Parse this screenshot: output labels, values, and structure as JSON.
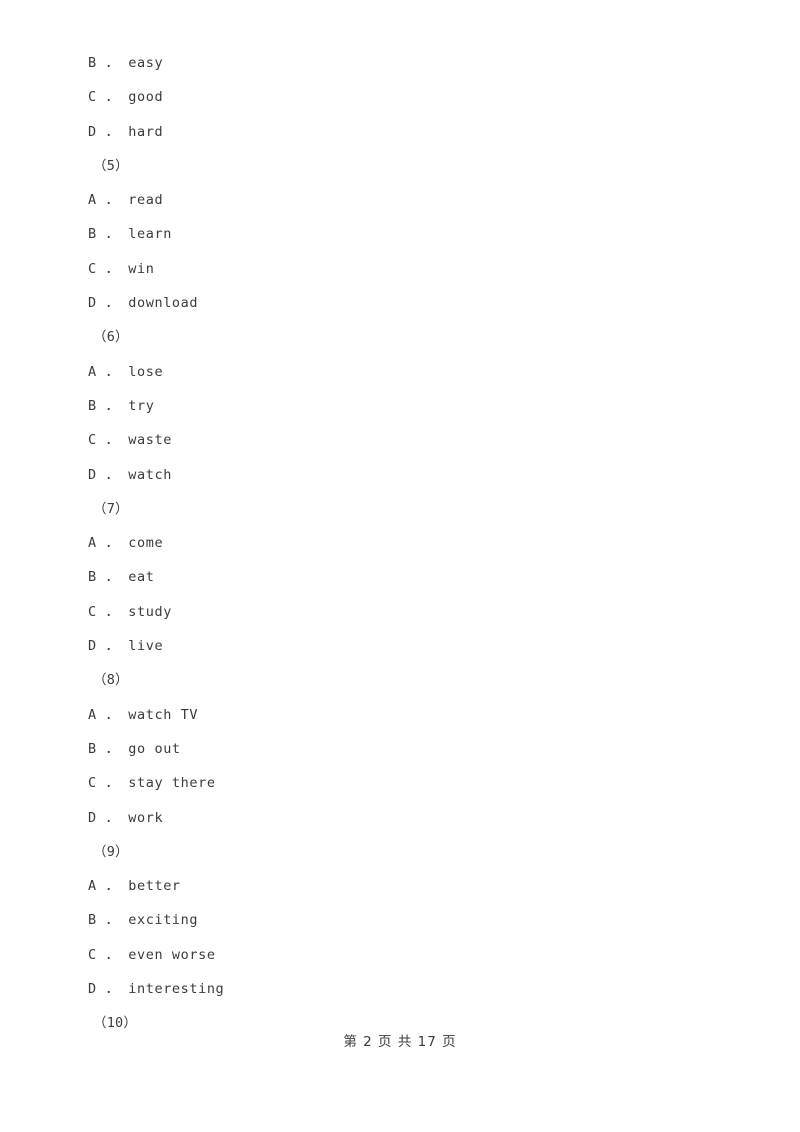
{
  "document": {
    "page_background": "#ffffff",
    "text_color": "#3b3b3b",
    "lines": [
      {
        "kind": "option",
        "text": "B ． easy"
      },
      {
        "kind": "option",
        "text": "C ． good"
      },
      {
        "kind": "option",
        "text": "D ． hard"
      },
      {
        "kind": "numbering",
        "text": "（5）"
      },
      {
        "kind": "option",
        "text": "A ． read"
      },
      {
        "kind": "option",
        "text": "B ． learn"
      },
      {
        "kind": "option",
        "text": "C ． win"
      },
      {
        "kind": "option",
        "text": "D ． download"
      },
      {
        "kind": "numbering",
        "text": "（6）"
      },
      {
        "kind": "option",
        "text": "A ． lose"
      },
      {
        "kind": "option",
        "text": "B ． try"
      },
      {
        "kind": "option",
        "text": "C ． waste"
      },
      {
        "kind": "option",
        "text": "D ． watch"
      },
      {
        "kind": "numbering",
        "text": "（7）"
      },
      {
        "kind": "option",
        "text": "A ． come"
      },
      {
        "kind": "option",
        "text": "B ． eat"
      },
      {
        "kind": "option",
        "text": "C ． study"
      },
      {
        "kind": "option",
        "text": "D ． live"
      },
      {
        "kind": "numbering",
        "text": "（8）"
      },
      {
        "kind": "option",
        "text": "A ． watch TV"
      },
      {
        "kind": "option",
        "text": "B ． go out"
      },
      {
        "kind": "option",
        "text": "C ． stay there"
      },
      {
        "kind": "option",
        "text": "D ． work"
      },
      {
        "kind": "numbering",
        "text": "（9）"
      },
      {
        "kind": "option",
        "text": "A ． better"
      },
      {
        "kind": "option",
        "text": "B ． exciting"
      },
      {
        "kind": "option",
        "text": "C ． even worse"
      },
      {
        "kind": "option",
        "text": "D ． interesting"
      },
      {
        "kind": "numbering",
        "text": "（10）"
      }
    ]
  },
  "footer": {
    "text": "第 2 页 共 17 页",
    "current_page": "2",
    "total_pages": "17"
  }
}
